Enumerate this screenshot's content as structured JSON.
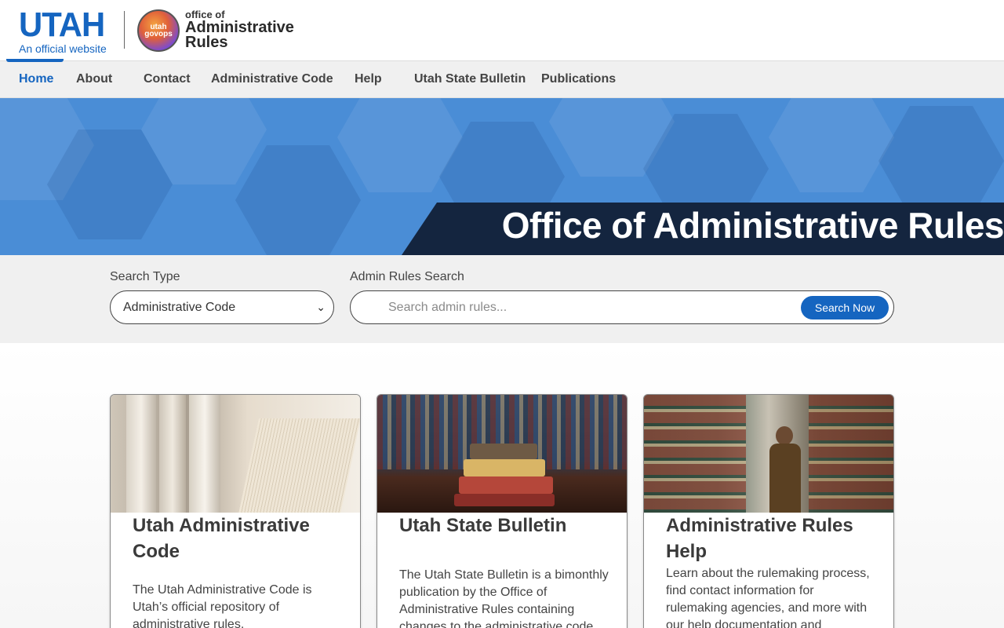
{
  "header": {
    "utah_logo": "UTAH",
    "utah_sub": "An official website",
    "badge_text_1": "utah",
    "badge_text_2": "govops",
    "office_small": "office of",
    "office_big_1": "Administrative",
    "office_big_2": "Rules"
  },
  "nav": {
    "items": [
      {
        "label": "Home",
        "active": true
      },
      {
        "label": "About"
      },
      {
        "label": "Contact"
      },
      {
        "label": "Administrative Code"
      },
      {
        "label": "Help"
      },
      {
        "label": "Utah State Bulletin"
      },
      {
        "label": "Publications"
      }
    ]
  },
  "hero": {
    "title": "Office of Administrative Rules"
  },
  "search": {
    "type_label": "Search Type",
    "type_value": "Administrative Code",
    "query_label": "Admin Rules Search",
    "placeholder": "Search admin rules...",
    "button_label": "Search Now"
  },
  "cards": [
    {
      "title": "Utah Administrative Code",
      "text": "The Utah Administrative Code is Utah’s official repository of administrative rules."
    },
    {
      "title": "Utah State Bulletin",
      "text": "The Utah State Bulletin is a bimonthly publication by the Office of Administrative Rules containing changes to the administrative code."
    },
    {
      "title": "Administrative Rules Help",
      "text": "Learn about the rulemaking process, find contact information for rulemaking agencies, and more with our help documentation and resources."
    }
  ],
  "colors": {
    "brand_blue": "#1565c0",
    "hero_blue": "#4a8dd6",
    "banner_navy": "#14253f"
  }
}
